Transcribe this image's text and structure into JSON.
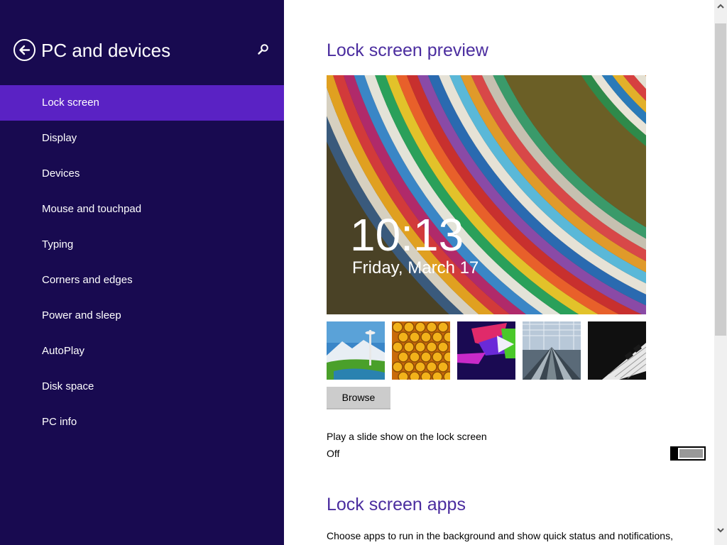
{
  "sidebar": {
    "title": "PC and devices",
    "back_icon": "back-arrow-icon",
    "search_icon": "search-icon",
    "items": [
      {
        "label": "Lock screen",
        "active": true
      },
      {
        "label": "Display"
      },
      {
        "label": "Devices"
      },
      {
        "label": "Mouse and touchpad"
      },
      {
        "label": "Typing"
      },
      {
        "label": "Corners and edges"
      },
      {
        "label": "Power and sleep"
      },
      {
        "label": "AutoPlay"
      },
      {
        "label": "Disk space"
      },
      {
        "label": "PC info"
      }
    ]
  },
  "main": {
    "preview_title": "Lock screen preview",
    "preview_time": "10:13",
    "preview_date": "Friday, March 17",
    "thumbnails": [
      {
        "name": "space-needle-thumbnail"
      },
      {
        "name": "honeycomb-thumbnail"
      },
      {
        "name": "geometric-shapes-thumbnail"
      },
      {
        "name": "escalator-thumbnail"
      },
      {
        "name": "piano-keys-thumbnail"
      }
    ],
    "browse_label": "Browse",
    "slideshow_label": "Play a slide show on the lock screen",
    "slideshow_state": "Off",
    "apps_title": "Lock screen apps",
    "apps_description": "Choose apps to run in the background and show quick status and notifications,"
  },
  "colors": {
    "sidebar_bg": "#180a50",
    "active_item": "#5a22c4",
    "heading": "#4b2d9f"
  }
}
